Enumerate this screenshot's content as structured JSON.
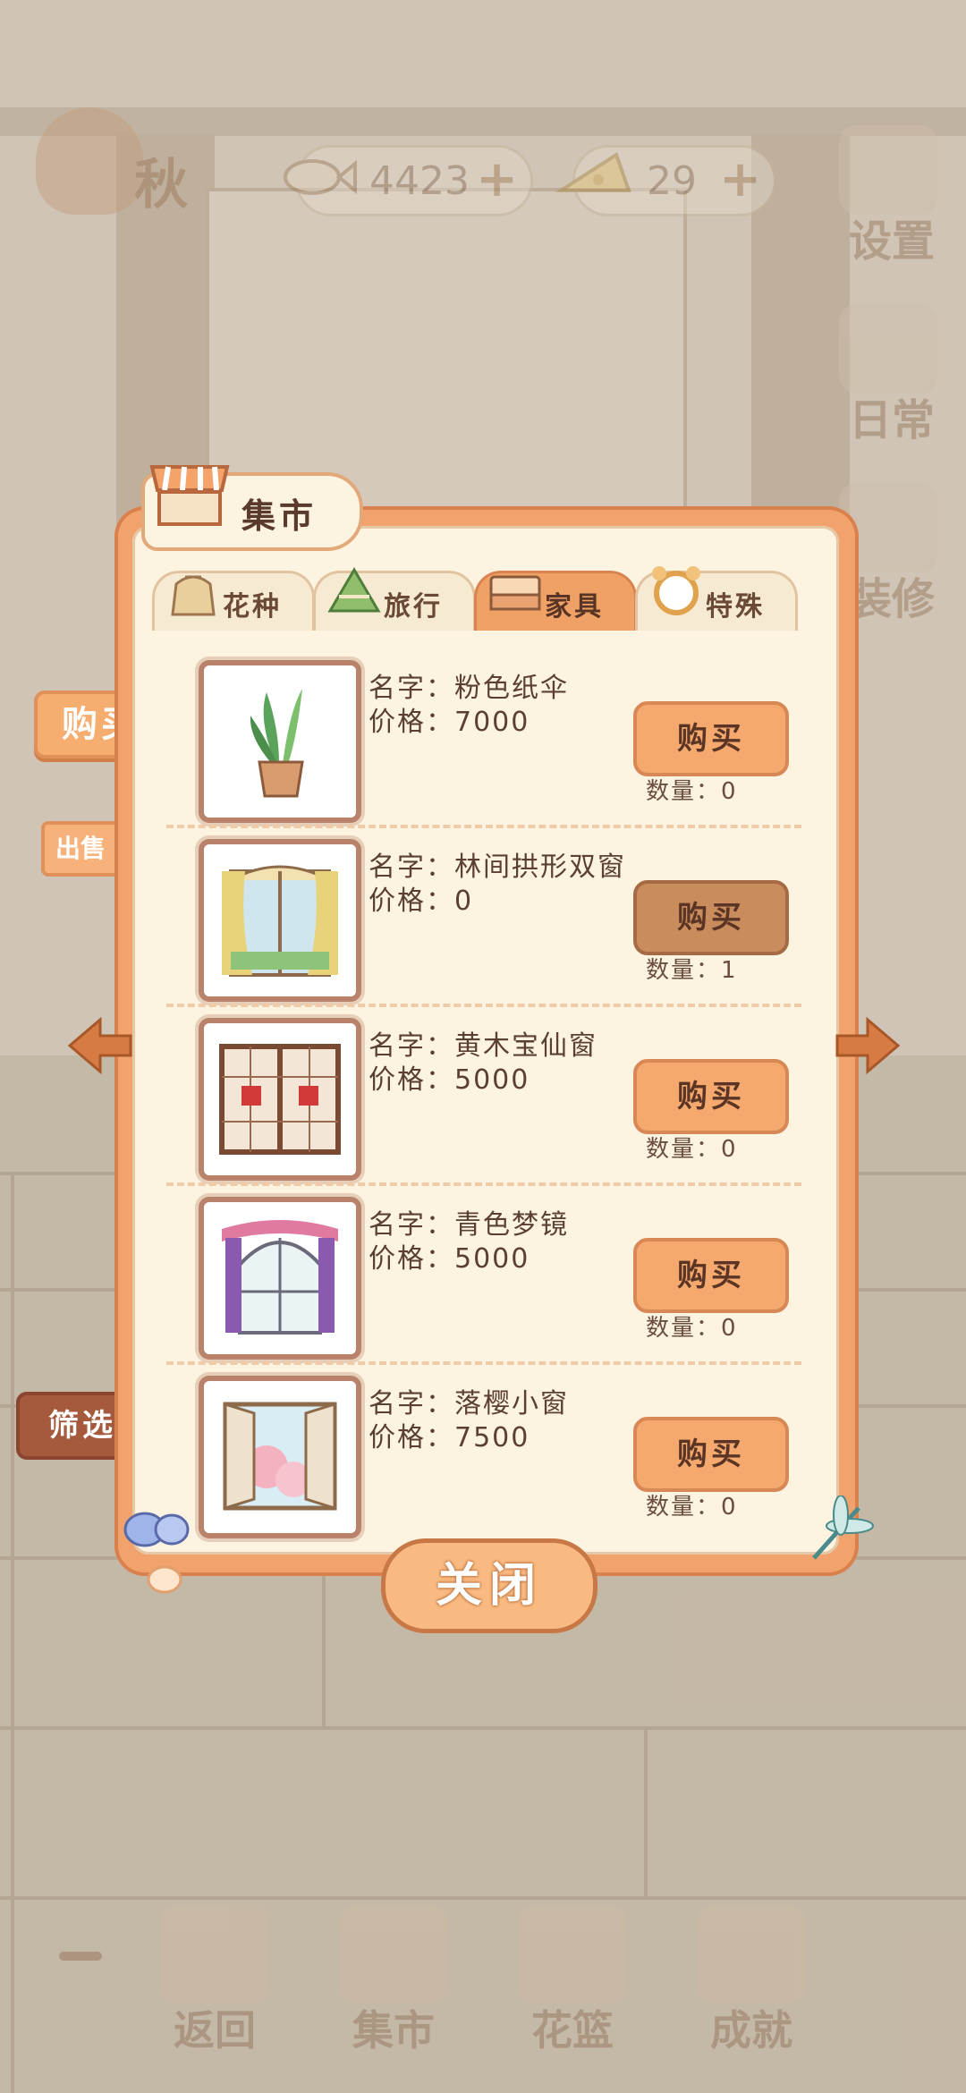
{
  "hud": {
    "season": "秋",
    "fish_count": "4423",
    "cheese_count": "29",
    "plus": "+",
    "settings_label": "设置",
    "daily_label": "日常",
    "repair_label": "装修"
  },
  "panel": {
    "title": "集市",
    "tabs": [
      {
        "label": "花种",
        "icon": "seed-bag-icon"
      },
      {
        "label": "旅行",
        "icon": "zongzi-icon"
      },
      {
        "label": "家具",
        "icon": "bed-icon",
        "active": true
      },
      {
        "label": "特殊",
        "icon": "frame-icon"
      }
    ],
    "items": [
      {
        "name": "名字：粉色纸伞",
        "price": "价格：7000",
        "buy_label": "购买",
        "qty": "数量：0",
        "owned": false,
        "thumb": "potted-plant"
      },
      {
        "name": "名字：林间拱形双窗",
        "price": "价格：0",
        "buy_label": "购买",
        "qty": "数量：1",
        "owned": true,
        "thumb": "arched-window"
      },
      {
        "name": "名字：黄木宝仙窗",
        "price": "价格：5000",
        "buy_label": "购买",
        "qty": "数量：0",
        "owned": false,
        "thumb": "wood-window"
      },
      {
        "name": "名字：青色梦镜",
        "price": "价格：5000",
        "buy_label": "购买",
        "qty": "数量：0",
        "owned": false,
        "thumb": "curtain-window"
      },
      {
        "name": "名字：落樱小窗",
        "price": "价格：7500",
        "buy_label": "购买",
        "qty": "数量：0",
        "owned": false,
        "thumb": "sakura-window"
      }
    ],
    "side_buy": "购买",
    "side_sell": "出售",
    "filter": "筛选",
    "close": "关闭"
  },
  "nav": {
    "back": "返回",
    "market": "集市",
    "basket": "花篮",
    "achievement": "成就"
  },
  "colors": {
    "panel_orange": "#f2a36d",
    "panel_cream": "#fcf3e1",
    "button_orange": "#f6a96e",
    "text_brown": "#5b4031"
  }
}
